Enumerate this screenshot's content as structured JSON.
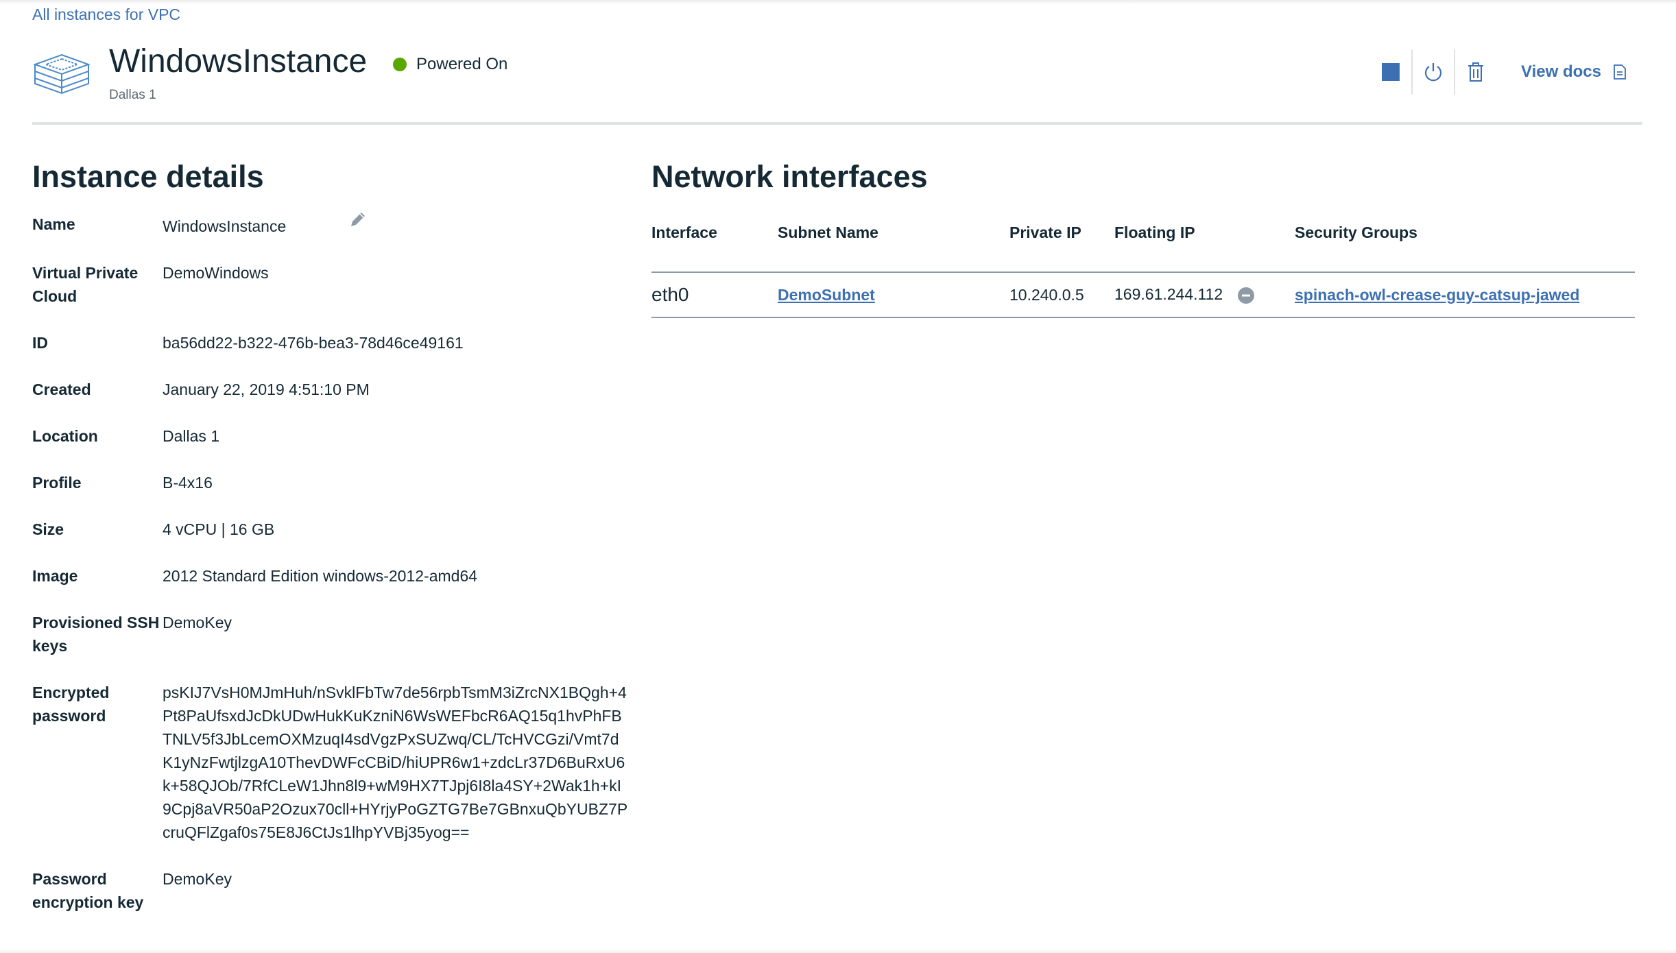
{
  "breadcrumb": {
    "label": "All instances for VPC"
  },
  "header": {
    "title": "WindowsInstance",
    "status": "Powered On",
    "status_color": "#5aa700",
    "subtitle": "Dallas 1",
    "icon": "server-stack-icon",
    "actions": [
      {
        "name": "stop-button",
        "icon": "stop-square-icon"
      },
      {
        "name": "power-button",
        "icon": "power-icon"
      },
      {
        "name": "delete-button",
        "icon": "trash-icon"
      }
    ],
    "view_docs": "View docs",
    "view_docs_icon": "document-icon"
  },
  "details": {
    "title": "Instance details",
    "rows": [
      {
        "label": "Name",
        "value": "WindowsInstance"
      },
      {
        "label": "Virtual Private Cloud",
        "value": "DemoWindows"
      },
      {
        "label": "ID",
        "value": "ba56dd22-b322-476b-bea3-78d46ce49161"
      },
      {
        "label": "Created",
        "value": "January 22, 2019 4:51:10 PM"
      },
      {
        "label": "Location",
        "value": "Dallas 1"
      },
      {
        "label": "Profile",
        "value": "B-4x16"
      },
      {
        "label": "Size",
        "value": "4 vCPU | 16 GB"
      },
      {
        "label": "Image",
        "value": "2012 Standard Edition windows-2012-amd64"
      },
      {
        "label": "Provisioned SSH keys",
        "value": "DemoKey"
      },
      {
        "label": "Encrypted password",
        "value": "psKIJ7VsH0MJmHuh/nSvklFbTw7de56rpbTsmM3iZrcNX1BQgh+4Pt8PaUfsxdJcDkUDwHukKuKzniN6WsWEFbcR6AQ15q1hvPhFBTNLV5f3JbLcemOXMzuqI4sdVgzPxSUZwq/CL/TcHVCGzi/Vmt7dK1yNzFwtjlzgA10ThevDWFcCBiD/hiUPR6w1+zdcLr37D6BuRxU6k+58QJOb/7RfCLeW1Jhn8l9+wM9HX7TJpj6I8la4SY+2Wak1h+kI9Cpj8aVR50aP2Ozux70cll+HYrjyPoGZTG7Be7GBnxuQbYUBZ7PcruQFlZgaf0s75E8J6CtJs1lhpYVBj35yog=="
      },
      {
        "label": "Password encryption key",
        "value": "DemoKey"
      }
    ],
    "edit_icon": "pencil-edit-icon"
  },
  "network": {
    "title": "Network interfaces",
    "columns": [
      "Interface",
      "Subnet Name",
      "Private IP",
      "Floating IP",
      "Security Groups"
    ],
    "rows": [
      {
        "interface": "eth0",
        "subnet": "DemoSubnet",
        "private_ip": "10.240.0.5",
        "floating_ip": "169.61.244.112",
        "security_group": "spinach-owl-crease-guy-catsup-jawed"
      }
    ],
    "remove_icon": "minus-circle-icon"
  },
  "colors": {
    "link": "#3d70b2",
    "text": "#152935",
    "status_green": "#5aa700"
  }
}
